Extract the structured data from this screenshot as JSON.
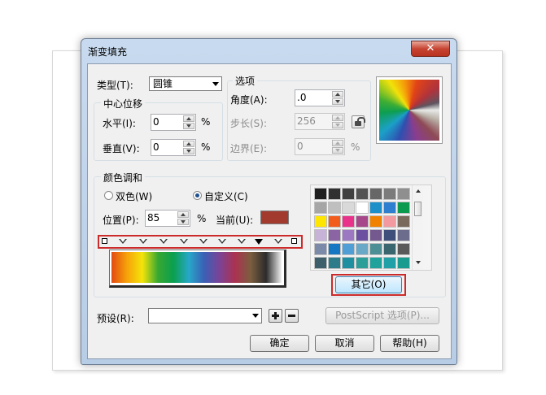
{
  "dialog": {
    "title": "渐变填充",
    "close_glyph": "✕"
  },
  "type_row": {
    "label": "类型(T):",
    "value": "圆锥"
  },
  "center_offset": {
    "title": "中心位移",
    "horizontal_label": "水平(I):",
    "horizontal_value": "0",
    "vertical_label": "垂直(V):",
    "vertical_value": "0",
    "unit": "%"
  },
  "options": {
    "title": "选项",
    "angle_label": "角度(A):",
    "angle_value": ".0",
    "steps_label": "步长(S):",
    "steps_value": "256",
    "edge_label": "边界(E):",
    "edge_value": "0",
    "unit": "%"
  },
  "color_blend": {
    "title": "颜色调和",
    "two_color_label": "双色(W)",
    "custom_label": "自定义(C)",
    "selected_mode": "custom",
    "position_label": "位置(P):",
    "position_value": "85",
    "unit": "%",
    "current_label": "当前(U):",
    "current_color": "#a23b2e",
    "gradient_stops": [
      "#e34a12",
      "#f6a20a",
      "#f4e40a",
      "#37a832",
      "#0b9f4f",
      "#27a7c8",
      "#3b5fb5",
      "#7b4396",
      "#ab3250",
      "#7b5e3f",
      "#2b2b2b",
      "#f0f0f0"
    ],
    "palette": [
      [
        "#1f1f1f",
        "#303030",
        "#404040",
        "#535353",
        "#676767",
        "#7b7b7b",
        "#8f8f8f"
      ],
      [
        "#a6a6a6",
        "#bfbfbf",
        "#d9d9d9",
        "#ffffff",
        "#1e90c9",
        "#2f7fd0",
        "#0c9a4e"
      ],
      [
        "#ffe600",
        "#f25d1d",
        "#e9338a",
        "#a6488a",
        "#f08200",
        "#f29a9f",
        "#7a6a5e"
      ],
      [
        "#c8b3d8",
        "#8a64a3",
        "#9d78c2",
        "#6b4fa0",
        "#74598f",
        "#3d4f7a",
        "#6c6c8c"
      ],
      [
        "#7b8aa8",
        "#1777c3",
        "#4f9fd6",
        "#6aa8c8",
        "#4c8f94",
        "#3a6670",
        "#5a5a5a"
      ],
      [
        "#3d5f6b",
        "#2e7c8a",
        "#1d8fa0",
        "#2b9e9a",
        "#1ea29b",
        "#22a0a8",
        "#1a9b8f"
      ]
    ],
    "other_button": "其它(O)"
  },
  "preset": {
    "label": "预设(R):",
    "value": "",
    "postscript_button": "PostScript 选项(P)..."
  },
  "footer": {
    "ok": "确定",
    "cancel": "取消",
    "help": "帮助(H)"
  }
}
